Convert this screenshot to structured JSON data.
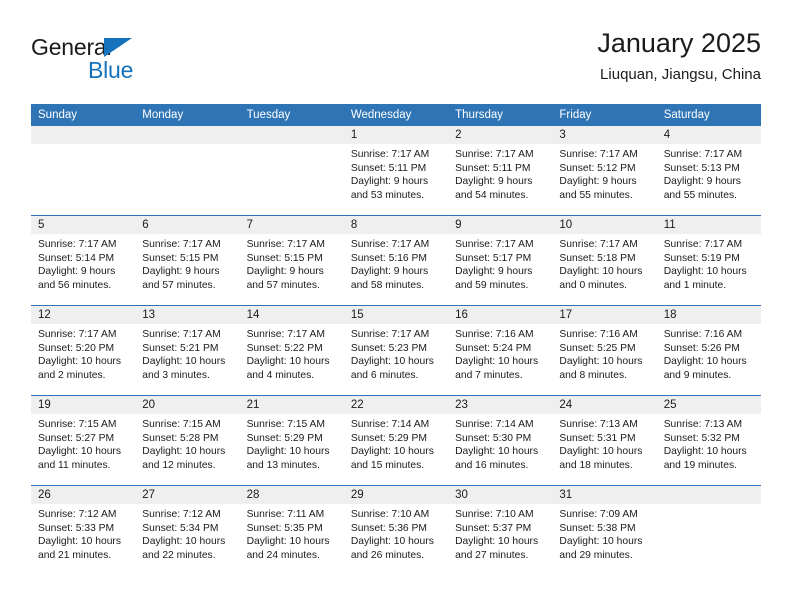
{
  "brand": {
    "name_line1": "General",
    "name_line2": "Blue",
    "logo_triangle_color": "#1573bc",
    "text_color": "#1b1b1b"
  },
  "header": {
    "title": "January 2025",
    "subtitle": "Liuquan, Jiangsu, China"
  },
  "theme": {
    "header_blue": "#2f75b5",
    "day_strip_gray": "#efefef",
    "page_background": "#ffffff"
  },
  "weekday_headers": [
    "Sunday",
    "Monday",
    "Tuesday",
    "Wednesday",
    "Thursday",
    "Friday",
    "Saturday"
  ],
  "weeks": [
    [
      {
        "day": "",
        "empty": true
      },
      {
        "day": "",
        "empty": true
      },
      {
        "day": "",
        "empty": true
      },
      {
        "day": "1",
        "sunrise": "Sunrise: 7:17 AM",
        "sunset": "Sunset: 5:11 PM",
        "daylight": "Daylight: 9 hours and 53 minutes."
      },
      {
        "day": "2",
        "sunrise": "Sunrise: 7:17 AM",
        "sunset": "Sunset: 5:11 PM",
        "daylight": "Daylight: 9 hours and 54 minutes."
      },
      {
        "day": "3",
        "sunrise": "Sunrise: 7:17 AM",
        "sunset": "Sunset: 5:12 PM",
        "daylight": "Daylight: 9 hours and 55 minutes."
      },
      {
        "day": "4",
        "sunrise": "Sunrise: 7:17 AM",
        "sunset": "Sunset: 5:13 PM",
        "daylight": "Daylight: 9 hours and 55 minutes."
      }
    ],
    [
      {
        "day": "5",
        "sunrise": "Sunrise: 7:17 AM",
        "sunset": "Sunset: 5:14 PM",
        "daylight": "Daylight: 9 hours and 56 minutes."
      },
      {
        "day": "6",
        "sunrise": "Sunrise: 7:17 AM",
        "sunset": "Sunset: 5:15 PM",
        "daylight": "Daylight: 9 hours and 57 minutes."
      },
      {
        "day": "7",
        "sunrise": "Sunrise: 7:17 AM",
        "sunset": "Sunset: 5:15 PM",
        "daylight": "Daylight: 9 hours and 57 minutes."
      },
      {
        "day": "8",
        "sunrise": "Sunrise: 7:17 AM",
        "sunset": "Sunset: 5:16 PM",
        "daylight": "Daylight: 9 hours and 58 minutes."
      },
      {
        "day": "9",
        "sunrise": "Sunrise: 7:17 AM",
        "sunset": "Sunset: 5:17 PM",
        "daylight": "Daylight: 9 hours and 59 minutes."
      },
      {
        "day": "10",
        "sunrise": "Sunrise: 7:17 AM",
        "sunset": "Sunset: 5:18 PM",
        "daylight": "Daylight: 10 hours and 0 minutes."
      },
      {
        "day": "11",
        "sunrise": "Sunrise: 7:17 AM",
        "sunset": "Sunset: 5:19 PM",
        "daylight": "Daylight: 10 hours and 1 minute."
      }
    ],
    [
      {
        "day": "12",
        "sunrise": "Sunrise: 7:17 AM",
        "sunset": "Sunset: 5:20 PM",
        "daylight": "Daylight: 10 hours and 2 minutes."
      },
      {
        "day": "13",
        "sunrise": "Sunrise: 7:17 AM",
        "sunset": "Sunset: 5:21 PM",
        "daylight": "Daylight: 10 hours and 3 minutes."
      },
      {
        "day": "14",
        "sunrise": "Sunrise: 7:17 AM",
        "sunset": "Sunset: 5:22 PM",
        "daylight": "Daylight: 10 hours and 4 minutes."
      },
      {
        "day": "15",
        "sunrise": "Sunrise: 7:17 AM",
        "sunset": "Sunset: 5:23 PM",
        "daylight": "Daylight: 10 hours and 6 minutes."
      },
      {
        "day": "16",
        "sunrise": "Sunrise: 7:16 AM",
        "sunset": "Sunset: 5:24 PM",
        "daylight": "Daylight: 10 hours and 7 minutes."
      },
      {
        "day": "17",
        "sunrise": "Sunrise: 7:16 AM",
        "sunset": "Sunset: 5:25 PM",
        "daylight": "Daylight: 10 hours and 8 minutes."
      },
      {
        "day": "18",
        "sunrise": "Sunrise: 7:16 AM",
        "sunset": "Sunset: 5:26 PM",
        "daylight": "Daylight: 10 hours and 9 minutes."
      }
    ],
    [
      {
        "day": "19",
        "sunrise": "Sunrise: 7:15 AM",
        "sunset": "Sunset: 5:27 PM",
        "daylight": "Daylight: 10 hours and 11 minutes."
      },
      {
        "day": "20",
        "sunrise": "Sunrise: 7:15 AM",
        "sunset": "Sunset: 5:28 PM",
        "daylight": "Daylight: 10 hours and 12 minutes."
      },
      {
        "day": "21",
        "sunrise": "Sunrise: 7:15 AM",
        "sunset": "Sunset: 5:29 PM",
        "daylight": "Daylight: 10 hours and 13 minutes."
      },
      {
        "day": "22",
        "sunrise": "Sunrise: 7:14 AM",
        "sunset": "Sunset: 5:29 PM",
        "daylight": "Daylight: 10 hours and 15 minutes."
      },
      {
        "day": "23",
        "sunrise": "Sunrise: 7:14 AM",
        "sunset": "Sunset: 5:30 PM",
        "daylight": "Daylight: 10 hours and 16 minutes."
      },
      {
        "day": "24",
        "sunrise": "Sunrise: 7:13 AM",
        "sunset": "Sunset: 5:31 PM",
        "daylight": "Daylight: 10 hours and 18 minutes."
      },
      {
        "day": "25",
        "sunrise": "Sunrise: 7:13 AM",
        "sunset": "Sunset: 5:32 PM",
        "daylight": "Daylight: 10 hours and 19 minutes."
      }
    ],
    [
      {
        "day": "26",
        "sunrise": "Sunrise: 7:12 AM",
        "sunset": "Sunset: 5:33 PM",
        "daylight": "Daylight: 10 hours and 21 minutes."
      },
      {
        "day": "27",
        "sunrise": "Sunrise: 7:12 AM",
        "sunset": "Sunset: 5:34 PM",
        "daylight": "Daylight: 10 hours and 22 minutes."
      },
      {
        "day": "28",
        "sunrise": "Sunrise: 7:11 AM",
        "sunset": "Sunset: 5:35 PM",
        "daylight": "Daylight: 10 hours and 24 minutes."
      },
      {
        "day": "29",
        "sunrise": "Sunrise: 7:10 AM",
        "sunset": "Sunset: 5:36 PM",
        "daylight": "Daylight: 10 hours and 26 minutes."
      },
      {
        "day": "30",
        "sunrise": "Sunrise: 7:10 AM",
        "sunset": "Sunset: 5:37 PM",
        "daylight": "Daylight: 10 hours and 27 minutes."
      },
      {
        "day": "31",
        "sunrise": "Sunrise: 7:09 AM",
        "sunset": "Sunset: 5:38 PM",
        "daylight": "Daylight: 10 hours and 29 minutes."
      },
      {
        "day": "",
        "empty": true
      }
    ]
  ]
}
